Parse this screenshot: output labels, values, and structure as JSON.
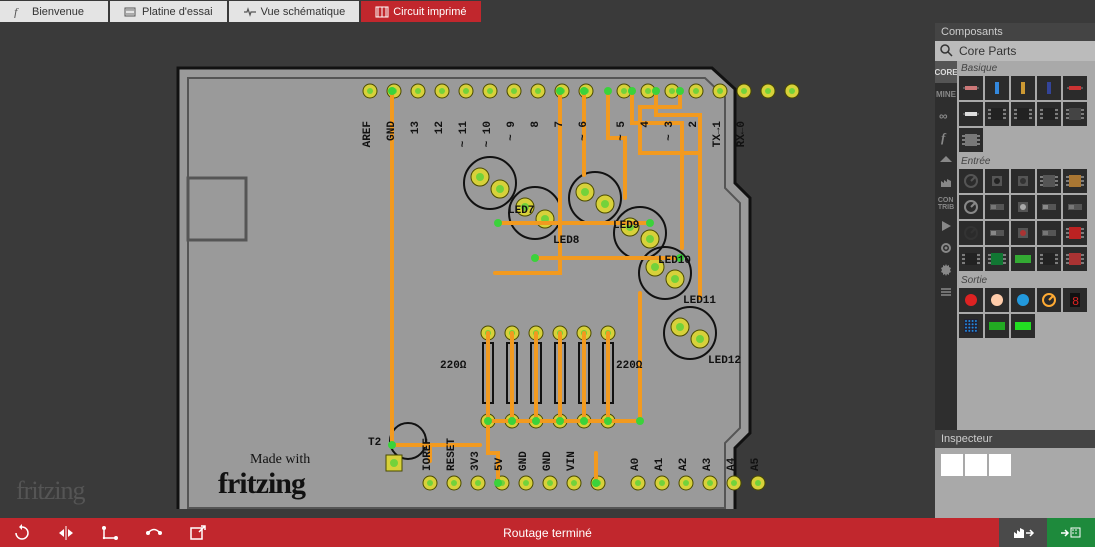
{
  "tabs": {
    "welcome": "Bienvenue",
    "breadboard": "Platine d'essai",
    "schematic": "Vue schématique",
    "pcb": "Circuit imprimé",
    "active": "pcb"
  },
  "brand": "fritzing",
  "board": {
    "made_with_label": "Made with",
    "made_with_brand": "fritzing",
    "res_left_label": "220Ω",
    "res_right_label": "220Ω",
    "t2_label": "T2",
    "led_labels": [
      "LED7",
      "LED8",
      "LED9",
      "LED10",
      "LED11",
      "LED12"
    ],
    "top_pin_labels": [
      "AREF",
      "GND",
      "13",
      "12",
      "~ 11",
      "~ 10",
      "~ 9",
      "8",
      "7",
      "~ 6",
      "~ 5",
      "4",
      "~ 3",
      "2",
      "TX→1",
      "RX←0"
    ],
    "bottom_pin_labels": [
      "IOREF",
      "RESET",
      "3V3",
      "5V",
      "GND",
      "GND",
      "VIN",
      "",
      "A0",
      "A1",
      "A2",
      "A3",
      "A4",
      "A5"
    ]
  },
  "right": {
    "parts_title": "Composants",
    "search_value": "Core Parts",
    "cat_basic": "Basique",
    "cat_input": "Entrée",
    "cat_output": "Sortie",
    "inspector_title": "Inspecteur"
  },
  "bins": [
    "CORE",
    "MINE",
    "∞",
    "f",
    "hat",
    "fac",
    "CON",
    "▶",
    "gear",
    "cog",
    "≡"
  ],
  "bottom": {
    "status": "Routage terminé"
  }
}
